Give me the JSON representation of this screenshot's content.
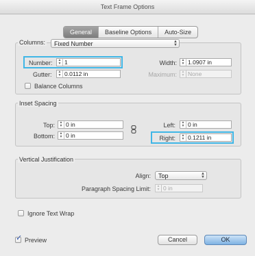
{
  "window": {
    "title": "Text Frame Options"
  },
  "tabs": [
    {
      "label": "General",
      "active": true
    },
    {
      "label": "Baseline Options",
      "active": false
    },
    {
      "label": "Auto-Size",
      "active": false
    }
  ],
  "columns": {
    "label": "Columns:",
    "type_value": "Fixed Number",
    "number_label": "Number:",
    "number_value": "1",
    "width_label": "Width:",
    "width_value": "1.0907 in",
    "gutter_label": "Gutter:",
    "gutter_value": "0.0112 in",
    "maximum_label": "Maximum:",
    "maximum_value": "None",
    "balance_label": "Balance Columns"
  },
  "inset": {
    "label": "Inset Spacing",
    "top_label": "Top:",
    "top_value": "0 in",
    "bottom_label": "Bottom:",
    "bottom_value": "0 in",
    "left_label": "Left:",
    "left_value": "0 in",
    "right_label": "Right:",
    "right_value": "0.1211 in"
  },
  "vertical": {
    "label": "Vertical Justification",
    "align_label": "Align:",
    "align_value": "Top",
    "spacing_label": "Paragraph Spacing Limit:",
    "spacing_value": "0 in"
  },
  "ignore_wrap_label": "Ignore Text Wrap",
  "preview_label": "Preview",
  "preview_checked": true,
  "buttons": {
    "cancel": "Cancel",
    "ok": "OK"
  },
  "colors": {
    "highlight": "#3fb6e6",
    "accent": "#7fb2e3"
  }
}
